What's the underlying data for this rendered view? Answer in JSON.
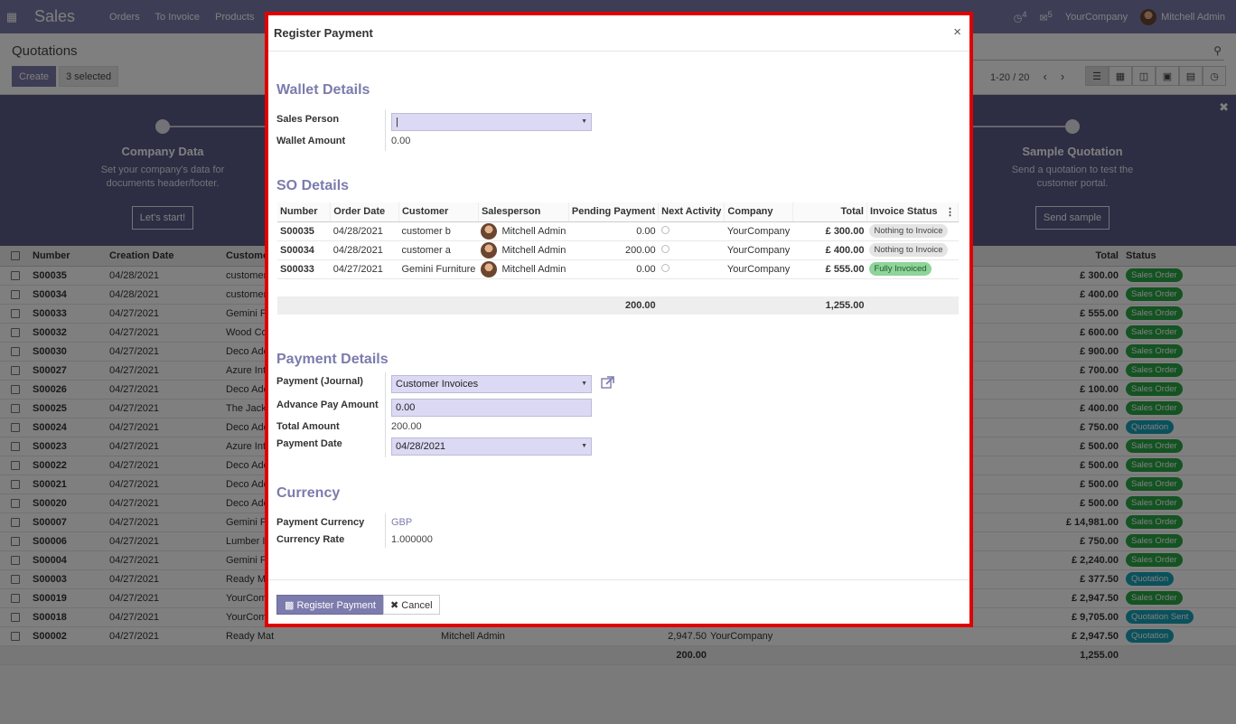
{
  "topnav": {
    "brand": "Sales",
    "menu": [
      "Orders",
      "To Invoice",
      "Products"
    ],
    "activity_count": "4",
    "message_count": "5",
    "company": "YourCompany",
    "user": "Mitchell Admin"
  },
  "control_panel": {
    "title": "Quotations",
    "create_label": "Create",
    "selected_label": "3 selected",
    "pager": "1-20 / 20"
  },
  "banner": {
    "steps": [
      {
        "title": "Company Data",
        "desc": "Set your company's data for documents header/footer.",
        "button": "Let's start!"
      },
      {
        "title": "Sample Quotation",
        "desc": "Send a quotation to test the customer portal.",
        "button": "Send sample"
      }
    ]
  },
  "list": {
    "columns": {
      "number": "Number",
      "creation_date": "Creation Date",
      "customer": "Custome",
      "total": "Total",
      "status": "Status"
    },
    "rows": [
      {
        "number": "S00035",
        "date": "04/28/2021",
        "customer": "customer",
        "total": "£ 300.00",
        "status": "Sales Order",
        "checked": true
      },
      {
        "number": "S00034",
        "date": "04/28/2021",
        "customer": "customer",
        "total": "£ 400.00",
        "status": "Sales Order",
        "checked": true
      },
      {
        "number": "S00033",
        "date": "04/27/2021",
        "customer": "Gemini F",
        "total": "£ 555.00",
        "status": "Sales Order",
        "checked": true
      },
      {
        "number": "S00032",
        "date": "04/27/2021",
        "customer": "Wood Co",
        "total": "£ 600.00",
        "status": "Sales Order"
      },
      {
        "number": "S00030",
        "date": "04/27/2021",
        "customer": "Deco Add",
        "total": "£ 900.00",
        "status": "Sales Order"
      },
      {
        "number": "S00027",
        "date": "04/27/2021",
        "customer": "Azure Int",
        "total": "£ 700.00",
        "status": "Sales Order"
      },
      {
        "number": "S00026",
        "date": "04/27/2021",
        "customer": "Deco Add",
        "total": "£ 100.00",
        "status": "Sales Order"
      },
      {
        "number": "S00025",
        "date": "04/27/2021",
        "customer": "The Jack",
        "total": "£ 400.00",
        "status": "Sales Order"
      },
      {
        "number": "S00024",
        "date": "04/27/2021",
        "customer": "Deco Add",
        "total": "£ 750.00",
        "status": "Quotation"
      },
      {
        "number": "S00023",
        "date": "04/27/2021",
        "customer": "Azure Int",
        "total": "£ 500.00",
        "status": "Sales Order"
      },
      {
        "number": "S00022",
        "date": "04/27/2021",
        "customer": "Deco Add",
        "total": "£ 500.00",
        "status": "Sales Order"
      },
      {
        "number": "S00021",
        "date": "04/27/2021",
        "customer": "Deco Add",
        "total": "£ 500.00",
        "status": "Sales Order"
      },
      {
        "number": "S00020",
        "date": "04/27/2021",
        "customer": "Deco Add",
        "total": "£ 500.00",
        "status": "Sales Order"
      },
      {
        "number": "S00007",
        "date": "04/27/2021",
        "customer": "Gemini F",
        "total": "£ 14,981.00",
        "status": "Sales Order"
      },
      {
        "number": "S00006",
        "date": "04/27/2021",
        "customer": "Lumber In",
        "total": "£ 750.00",
        "status": "Sales Order"
      },
      {
        "number": "S00004",
        "date": "04/27/2021",
        "customer": "Gemini F",
        "total": "£ 2,240.00",
        "status": "Sales Order"
      },
      {
        "number": "S00003",
        "date": "04/27/2021",
        "customer": "Ready Ma",
        "total": "£ 377.50",
        "status": "Quotation"
      },
      {
        "number": "S00019",
        "date": "04/27/2021",
        "customer": "YourCom",
        "total": "£ 2,947.50",
        "status": "Sales Order"
      },
      {
        "number": "S00018",
        "date": "04/27/2021",
        "customer": "YourCom",
        "total": "£ 9,705.00",
        "status": "Quotation Sent"
      },
      {
        "number": "S00002",
        "date": "04/27/2021",
        "customer": "Ready Mat",
        "salesperson": "Mitchell Admin",
        "pending": "2,947.50",
        "company": "YourCompany",
        "total": "£ 2,947.50",
        "status": "Quotation"
      }
    ],
    "footer_pending": "200.00",
    "footer_total": "1,255.00"
  },
  "modal": {
    "title": "Register Payment",
    "close": "×",
    "wallet": {
      "heading": "Wallet Details",
      "sales_person_label": "Sales Person",
      "sales_person_value": "|",
      "wallet_amount_label": "Wallet Amount",
      "wallet_amount_value": "0.00"
    },
    "so": {
      "heading": "SO Details",
      "columns": [
        "Number",
        "Order Date",
        "Customer",
        "Salesperson",
        "Pending Payment",
        "Next Activity",
        "Company",
        "Total",
        "Invoice Status"
      ],
      "rows": [
        {
          "number": "S00035",
          "date": "04/28/2021",
          "customer": "customer b",
          "salesperson": "Mitchell Admin",
          "pending": "0.00",
          "company": "YourCompany",
          "total": "£ 300.00",
          "status": "Nothing to Invoice"
        },
        {
          "number": "S00034",
          "date": "04/28/2021",
          "customer": "customer a",
          "salesperson": "Mitchell Admin",
          "pending": "200.00",
          "company": "YourCompany",
          "total": "£ 400.00",
          "status": "Nothing to Invoice"
        },
        {
          "number": "S00033",
          "date": "04/27/2021",
          "customer": "Gemini Furniture",
          "salesperson": "Mitchell Admin",
          "pending": "0.00",
          "company": "YourCompany",
          "total": "£ 555.00",
          "status": "Fully Invoiced"
        }
      ],
      "footer_pending": "200.00",
      "footer_total": "1,255.00"
    },
    "payment": {
      "heading": "Payment Details",
      "journal_label": "Payment (Journal)",
      "journal_value": "Customer Invoices",
      "advance_label": "Advance Pay Amount",
      "advance_value": "0.00",
      "total_label": "Total Amount",
      "total_value": "200.00",
      "date_label": "Payment Date",
      "date_value": "04/28/2021"
    },
    "currency": {
      "heading": "Currency",
      "payment_currency_label": "Payment Currency",
      "payment_currency_value": "GBP",
      "rate_label": "Currency Rate",
      "rate_value": "1.000000"
    },
    "buttons": {
      "register": "Register Payment",
      "cancel": "Cancel"
    }
  }
}
